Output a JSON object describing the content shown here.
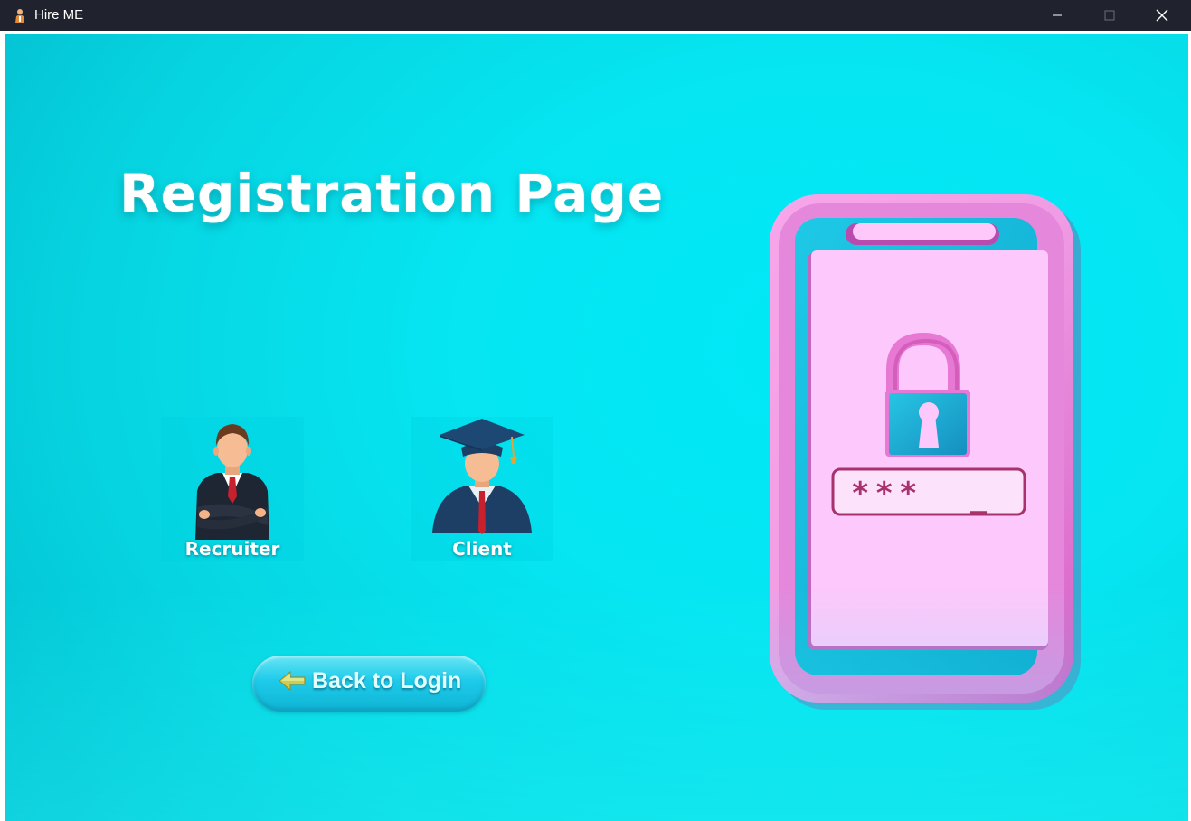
{
  "window": {
    "title": "Hire ME",
    "controls": [
      "minimize",
      "maximize",
      "close"
    ]
  },
  "page": {
    "title": "Registration Page"
  },
  "roles": [
    {
      "label": "Recruiter",
      "icon": "businessman-icon"
    },
    {
      "label": "Client",
      "icon": "graduate-icon"
    }
  ],
  "back_button": {
    "label": "Back to Login",
    "icon": "left-arrow-icon"
  },
  "illustration": {
    "icon": "phone-lock-icon",
    "password_mask": "***",
    "password_cursor": "_"
  },
  "colors": {
    "background": "#00e5f2",
    "accent_pink": "#e86bc4",
    "button": "#14b5dc"
  }
}
